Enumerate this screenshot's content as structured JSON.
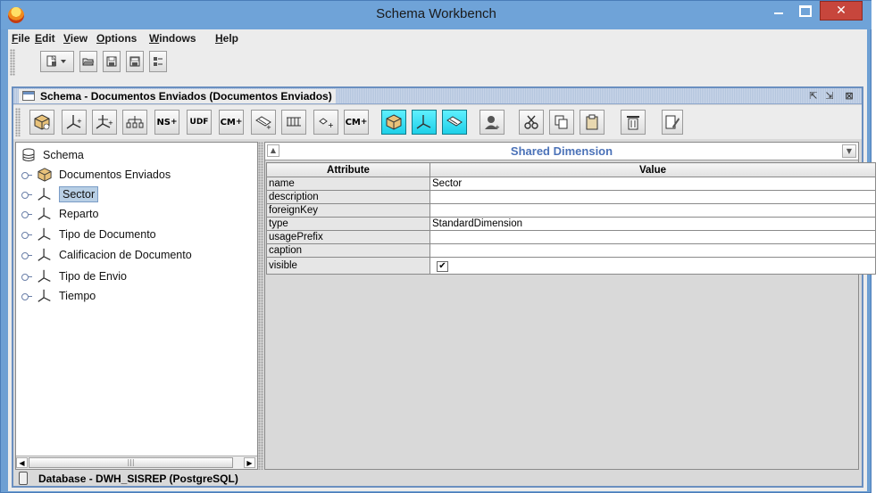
{
  "window": {
    "title": "Schema Workbench"
  },
  "menu": [
    {
      "label": "File"
    },
    {
      "label": "Edit"
    },
    {
      "label": "View"
    },
    {
      "label": "Options"
    },
    {
      "label": "Windows"
    },
    {
      "label": "Help"
    }
  ],
  "main_toolbar": {
    "buttons": [
      "new-icon",
      "dropdown-arrow-icon",
      "open-icon",
      "save-icon",
      "save-as-icon",
      "preferences-icon"
    ]
  },
  "schema_window": {
    "title": "Schema - Documentos Enviados (Documentos Enviados)",
    "controls": [
      "iconify-icon",
      "maximize-icon",
      "close-icon"
    ]
  },
  "schema_toolbar": {
    "buttons": [
      {
        "name": "add-cube-button",
        "icon": "cube-icon"
      },
      {
        "name": "add-dimension-button",
        "icon": "dimension-icon"
      },
      {
        "name": "add-dimension-usage-button",
        "icon": "dimension-usage-icon"
      },
      {
        "name": "add-hierarchy-button",
        "icon": "hierarchy-icon"
      },
      {
        "name": "add-named-set-button",
        "icon": "named-set-icon",
        "text": "NS"
      },
      {
        "name": "add-user-defined-function-button",
        "icon": "udf-icon",
        "text": "UDF"
      },
      {
        "name": "add-calculated-member-button",
        "icon": "calculated-member-icon",
        "text": "CM"
      },
      {
        "name": "add-measure-button",
        "icon": "measure-icon"
      },
      {
        "name": "add-level-button",
        "icon": "level-icon"
      },
      {
        "name": "add-property-button",
        "icon": "property-icon"
      },
      {
        "name": "add-cube-calculated-member-button",
        "icon": "cube-calculated-member-icon",
        "text": "CM"
      },
      {
        "name": "add-virtual-cube-button",
        "icon": "virtual-cube-icon"
      },
      {
        "name": "add-virtual-dimension-button",
        "icon": "virtual-dimension-icon"
      },
      {
        "name": "add-virtual-measure-button",
        "icon": "virtual-measure-icon"
      },
      {
        "name": "add-role-button",
        "icon": "role-icon"
      },
      {
        "name": "cut-button",
        "icon": "scissors-icon"
      },
      {
        "name": "copy-button",
        "icon": "copy-icon"
      },
      {
        "name": "paste-button",
        "icon": "paste-icon"
      },
      {
        "name": "delete-button",
        "icon": "trash-icon"
      },
      {
        "name": "edit-mode-button",
        "icon": "edit-icon"
      }
    ]
  },
  "tree": {
    "root": "Schema",
    "items": [
      {
        "label": "Documentos Enviados",
        "icon": "cube-icon",
        "selected": false
      },
      {
        "label": "Sector",
        "icon": "dimension-icon",
        "selected": true
      },
      {
        "label": "Reparto",
        "icon": "dimension-icon",
        "selected": false
      },
      {
        "label": "Tipo de Documento",
        "icon": "dimension-icon",
        "selected": false
      },
      {
        "label": "Calificacion de Documento",
        "icon": "dimension-icon",
        "selected": false
      },
      {
        "label": "Tipo de Envio",
        "icon": "dimension-icon",
        "selected": false
      },
      {
        "label": "Tiempo",
        "icon": "dimension-icon",
        "selected": false
      }
    ]
  },
  "properties": {
    "title": "Shared Dimension",
    "headers": [
      "Attribute",
      "Value"
    ],
    "rows": [
      {
        "attribute": "name",
        "value": "Sector"
      },
      {
        "attribute": "description",
        "value": ""
      },
      {
        "attribute": "foreignKey",
        "value": ""
      },
      {
        "attribute": "type",
        "value": "StandardDimension"
      },
      {
        "attribute": "usagePrefix",
        "value": ""
      },
      {
        "attribute": "caption",
        "value": ""
      },
      {
        "attribute": "visible",
        "value": "",
        "checkbox": true,
        "checked": true
      }
    ]
  },
  "status": {
    "text": "Database - DWH_SISREP (PostgreSQL)"
  },
  "colors": {
    "titlebar": "#6fa3d8",
    "close_button": "#c7463c",
    "highlight_button": "#1ed0e8",
    "panel_title": "#4b72b8",
    "selection": "#b8cfe5"
  }
}
